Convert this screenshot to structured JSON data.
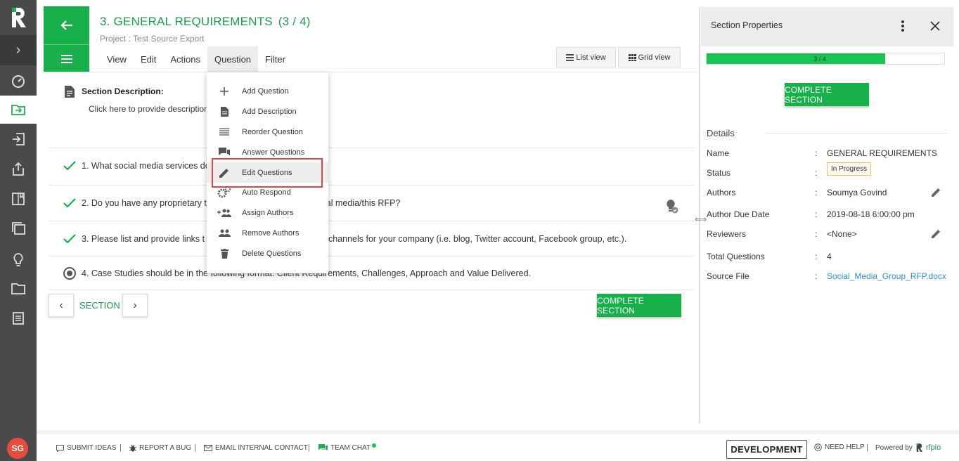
{
  "header": {
    "title": "3. GENERAL REQUIREMENTS",
    "section_count": "(3 / 4)",
    "project": "Project : Test Source Export"
  },
  "menubar": [
    "View",
    "Edit",
    "Actions",
    "Question",
    "Filter"
  ],
  "view_toggle": {
    "list": "List view",
    "grid": "Grid view"
  },
  "section_description": {
    "label": "Section Description:",
    "placeholder": "Click here to provide description"
  },
  "questions": [
    {
      "text": "1. What social media services do",
      "state": "complete"
    },
    {
      "text": "2. Do you have any proprietary t",
      "suffix": "ial media/this RFP?",
      "state": "complete"
    },
    {
      "text": "3. Please list and provide links t",
      "suffix": "channels for your company (i.e. blog, Twitter account, Facebook group, etc.).",
      "state": "complete"
    },
    {
      "text": "4. Case Studies should be in the following format: Client Requirements, Challenges, Approach and Value Delivered.",
      "state": "in-progress"
    }
  ],
  "question_menu": [
    {
      "label": "Add Question",
      "icon": "plus-icon"
    },
    {
      "label": "Add Description",
      "icon": "document-icon"
    },
    {
      "label": "Reorder Question",
      "icon": "reorder-icon"
    },
    {
      "label": "Answer Questions",
      "icon": "chat-icon"
    },
    {
      "label": "Edit Questions",
      "icon": "pencil-icon",
      "highlighted": true
    },
    {
      "label": "Auto Respond",
      "icon": "gears-icon"
    },
    {
      "label": "Assign Authors",
      "icon": "add-users-icon"
    },
    {
      "label": "Remove Authors",
      "icon": "users-icon"
    },
    {
      "label": "Delete Questions",
      "icon": "trash-icon"
    }
  ],
  "pager": {
    "label": "SECTION"
  },
  "complete_label": "COMPLETE SECTION",
  "properties": {
    "title": "Section Properties",
    "progress_label": "3 / 4",
    "progress_fraction": 0.75,
    "details_heading": "Details",
    "rows": [
      {
        "key": "Name",
        "value": "GENERAL REQUIREMENTS"
      },
      {
        "key": "Status",
        "value": "In Progress"
      },
      {
        "key": "Authors",
        "value": "Soumya Govind"
      },
      {
        "key": "Author Due Date",
        "value": "2019-08-18 6:00:00 pm"
      },
      {
        "key": "Reviewers",
        "value": "<None>"
      },
      {
        "key": "Total Questions",
        "value": "4"
      },
      {
        "key": "Source File",
        "value": "Social_Media_Group_RFP.docx"
      }
    ],
    "colon": ":"
  },
  "user": {
    "initials": "SG"
  },
  "footer": {
    "submit_ideas": "SUBMIT IDEAS",
    "report_bug": "REPORT A BUG",
    "email_contact": "EMAIL INTERNAL CONTACT",
    "team_chat": "TEAM CHAT",
    "environment": "DEVELOPMENT",
    "need_help": "NEED HELP",
    "powered_by": "Powered by",
    "brand": "rfpio",
    "separator": "|"
  },
  "colors": {
    "brand_green": "#18b04a",
    "rail": "#4a4a4a",
    "link": "#2a8fd6",
    "highlight_border": "#e04646"
  }
}
